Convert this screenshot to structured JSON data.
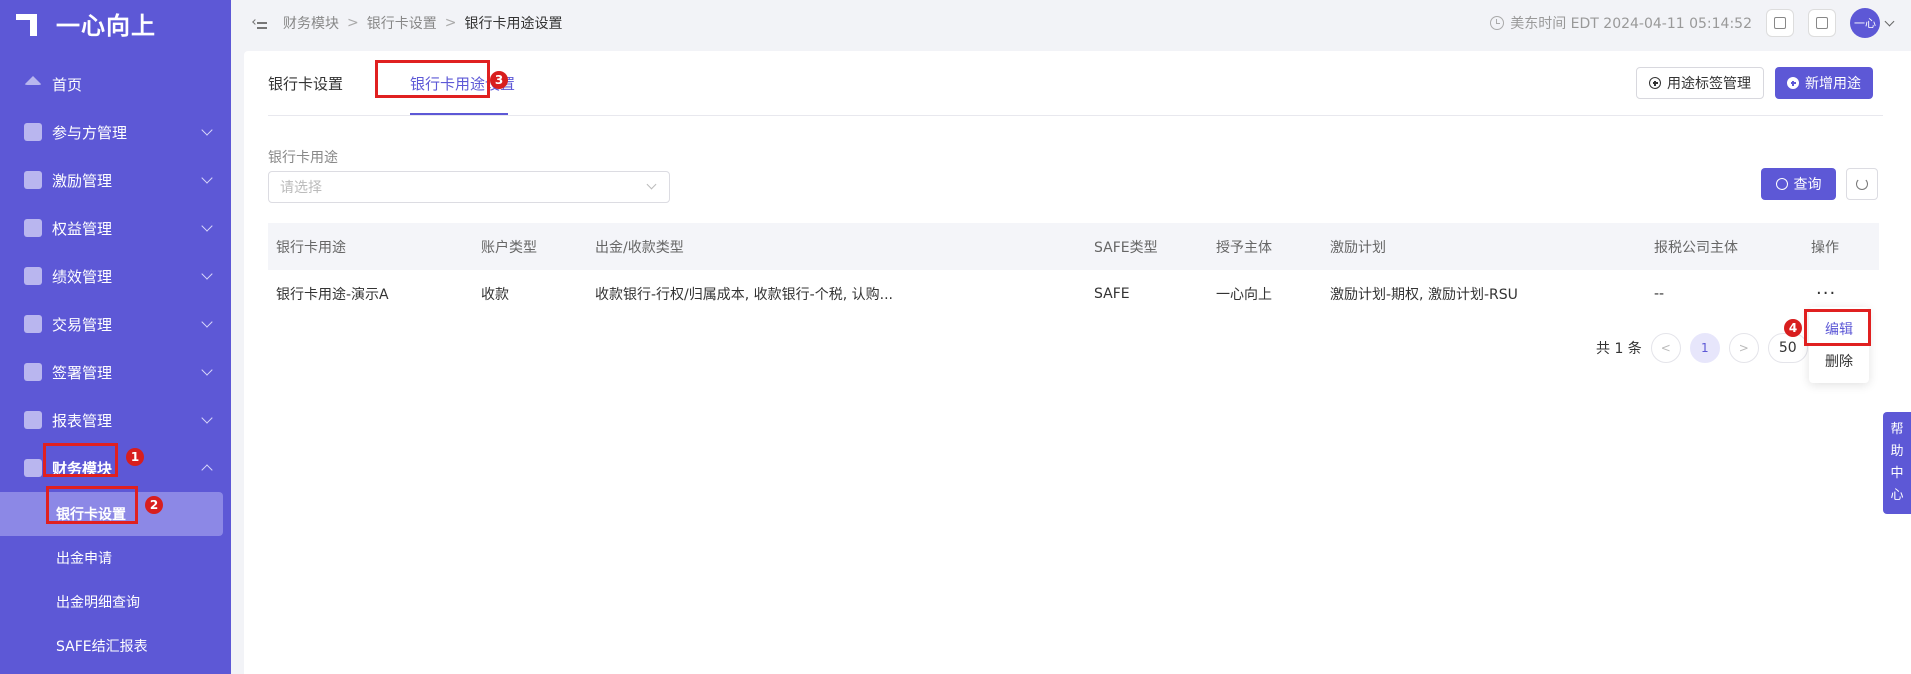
{
  "app": {
    "name": "一心向上"
  },
  "sidebar": {
    "items": [
      {
        "label": "首页"
      },
      {
        "label": "参与方管理"
      },
      {
        "label": "激励管理"
      },
      {
        "label": "权益管理"
      },
      {
        "label": "绩效管理"
      },
      {
        "label": "交易管理"
      },
      {
        "label": "签署管理"
      },
      {
        "label": "报表管理"
      },
      {
        "label": "财务模块"
      }
    ],
    "submenu": [
      {
        "label": "银行卡设置"
      },
      {
        "label": "出金申请"
      },
      {
        "label": "出金明细查询"
      },
      {
        "label": "SAFE结汇报表"
      }
    ]
  },
  "header": {
    "breadcrumb": [
      "财务模块",
      "银行卡设置",
      "银行卡用途设置"
    ],
    "time": "美东时间 EDT 2024-04-11 05:14:52",
    "avatar": "一心"
  },
  "tabs": [
    {
      "label": "银行卡设置"
    },
    {
      "label": "银行卡用途设置"
    }
  ],
  "toolbar": {
    "tag_manage": "用途标签管理",
    "add_usage": "新增用途"
  },
  "filter": {
    "label": "银行卡用途",
    "placeholder": "请选择",
    "search": "查询"
  },
  "table": {
    "columns": [
      "银行卡用途",
      "账户类型",
      "出金/收款类型",
      "SAFE类型",
      "授予主体",
      "激励计划",
      "报税公司主体",
      "操作"
    ],
    "rows": [
      {
        "usage": "银行卡用途-演示A",
        "account_type": "收款",
        "payout_type": "收款银行-行权/归属成本, 收款银行-个税, 认购...",
        "safe_type": "SAFE",
        "grantor": "一心向上",
        "plan": "激励计划-期权, 激励计划-RSU",
        "tax_entity": "--",
        "action": "···"
      }
    ]
  },
  "pagination": {
    "total": "共 1 条",
    "prev": "<",
    "page": "1",
    "next": ">",
    "page_size": "50"
  },
  "dropdown": {
    "edit": "编辑",
    "delete": "删除"
  },
  "annotations": [
    "1",
    "2",
    "3",
    "4"
  ],
  "help": {
    "chars": [
      "帮",
      "助",
      "中",
      "心"
    ]
  },
  "colors": {
    "primary": "#5d58d6",
    "highlight": "#e02020",
    "badge": "#d81e1e"
  }
}
